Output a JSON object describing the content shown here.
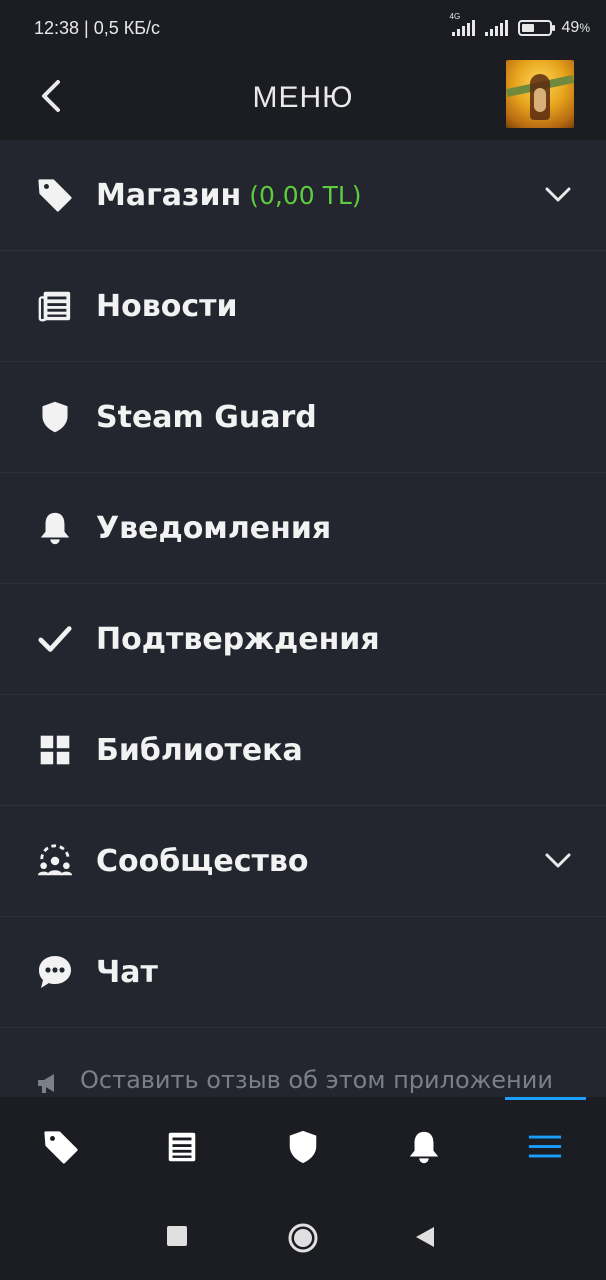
{
  "status_bar": {
    "time_speed": "12:38 | 0,5 КБ/с",
    "network_label": "4G",
    "battery_percent_text": "49",
    "battery_percent_sign": "%",
    "battery_level": 0.49
  },
  "header": {
    "title": "МЕНЮ"
  },
  "menu": {
    "items": [
      {
        "label": "Магазин",
        "extra": "(0,00 TL)",
        "icon": "tag-icon",
        "expandable": true
      },
      {
        "label": "Новости",
        "icon": "newspaper-icon",
        "expandable": false
      },
      {
        "label": "Steam Guard",
        "icon": "shield-icon",
        "expandable": false
      },
      {
        "label": "Уведомления",
        "icon": "bell-icon",
        "expandable": false
      },
      {
        "label": "Подтверждения",
        "icon": "checkmark-icon",
        "expandable": false
      },
      {
        "label": "Библиотека",
        "icon": "grid-icon",
        "expandable": false
      },
      {
        "label": "Сообщество",
        "icon": "community-icon",
        "expandable": true
      },
      {
        "label": "Чат",
        "icon": "chat-icon",
        "expandable": false
      }
    ]
  },
  "feedback": {
    "text": "Оставить отзыв об этом приложении",
    "icon": "megaphone-icon"
  },
  "bottom_nav": {
    "tabs": [
      "tag-icon",
      "newspaper-icon",
      "shield-icon",
      "bell-icon",
      "menu-icon"
    ],
    "active": "menu-icon"
  },
  "colors": {
    "background": "#23262e",
    "bar": "#1b1d22",
    "balance_green": "#5ecc3f",
    "active_blue": "#1a9fff"
  }
}
